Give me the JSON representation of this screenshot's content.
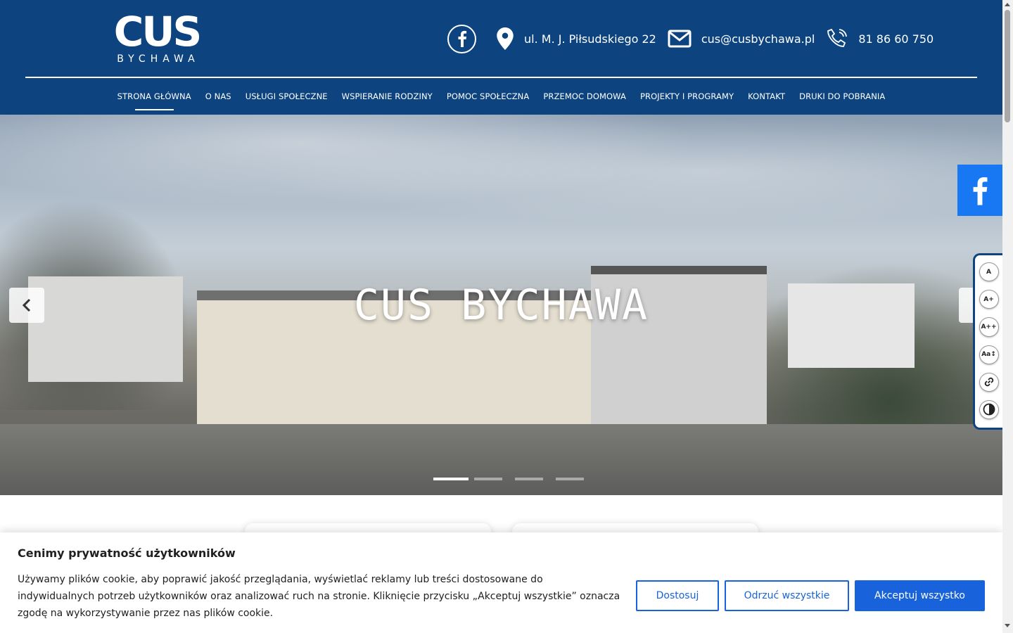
{
  "logo": {
    "main": "CUS",
    "sub": "BYCHAWA"
  },
  "contacts": {
    "address": "ul. M. J. Piłsudskiego 22",
    "email": "cus@cusbychawa.pl",
    "phone": "81 86 60 750"
  },
  "nav": {
    "items": [
      "STRONA GŁÓWNA",
      "O NAS",
      "USŁUGI SPOŁECZNE",
      "WSPIERANIE RODZINY",
      "POMOC SPOŁECZNA",
      "PRZEMOC DOMOWA",
      "PROJEKTY I PROGRAMY",
      "KONTAKT",
      "DRUKI DO POBRANIA"
    ],
    "active_index": 0
  },
  "hero": {
    "title": "CUS BYCHAWA",
    "slides": 4,
    "active_slide": 1
  },
  "accessibility": {
    "buttons": [
      "A",
      "A+",
      "A++",
      "Aa↕",
      "link-icon",
      "contrast-icon"
    ]
  },
  "cookie": {
    "title": "Cenimy prywatność użytkowników",
    "text": "Używamy plików cookie, aby poprawić jakość przeglądania, wyświetlać reklamy lub treści dostosowane do indywidualnych potrzeb użytkowników oraz analizować ruch na stronie. Kliknięcie przycisku „Akceptuj wszystkie” oznacza zgodę na wykorzystywanie przez nas plików cookie.",
    "customize": "Dostosuj",
    "reject": "Odrzuć wszystkie",
    "accept": "Akceptuj wszystko"
  },
  "colors": {
    "header": "#0d4480",
    "facebook": "#1877f2",
    "cookie_accent": "#1863dc"
  }
}
